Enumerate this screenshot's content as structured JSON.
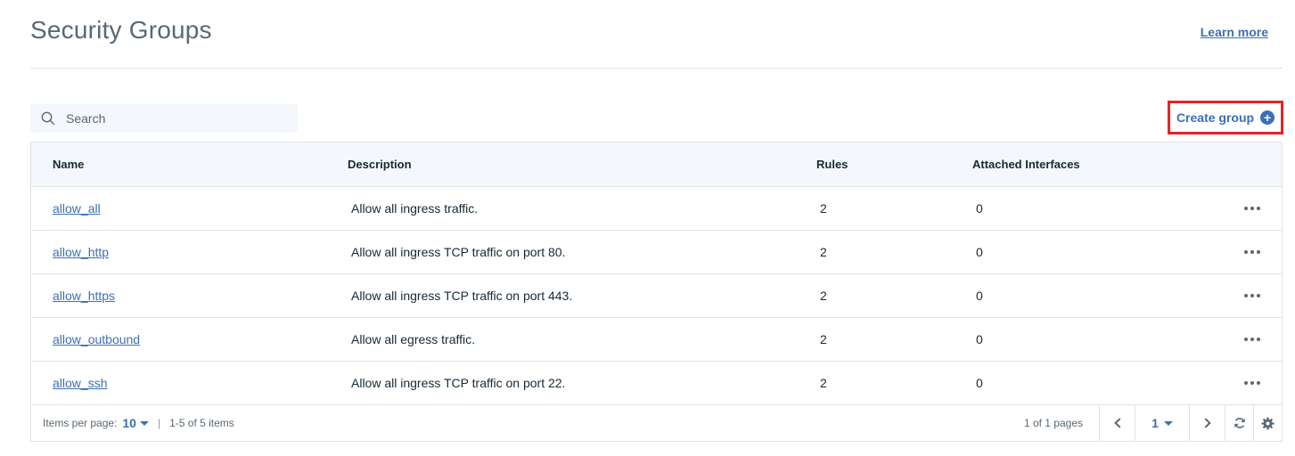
{
  "header": {
    "title": "Security Groups",
    "learn_more": "Learn more"
  },
  "toolbar": {
    "search_placeholder": "Search",
    "create_label": "Create group"
  },
  "table": {
    "columns": [
      "Name",
      "Description",
      "Rules",
      "Attached Interfaces"
    ],
    "rows": [
      {
        "name": "allow_all",
        "description": "Allow all ingress traffic.",
        "rules": "2",
        "attached": "0"
      },
      {
        "name": "allow_http",
        "description": "Allow all ingress TCP traffic on port 80.",
        "rules": "2",
        "attached": "0"
      },
      {
        "name": "allow_https",
        "description": "Allow all ingress TCP traffic on port 443.",
        "rules": "2",
        "attached": "0"
      },
      {
        "name": "allow_outbound",
        "description": "Allow all egress traffic.",
        "rules": "2",
        "attached": "0"
      },
      {
        "name": "allow_ssh",
        "description": "Allow all ingress TCP traffic on port 22.",
        "rules": "2",
        "attached": "0"
      }
    ]
  },
  "pagination": {
    "items_per_page_label": "Items per page:",
    "items_per_page_value": "10",
    "range_text": "1-5 of 5 items",
    "pages_text": "1 of 1 pages",
    "current_page": "1"
  },
  "icons": [
    "search-icon",
    "plus-circle-icon",
    "overflow-menu-icon",
    "chevron-down-icon",
    "chevron-left-icon",
    "chevron-right-icon",
    "refresh-icon",
    "gear-icon"
  ],
  "colors": {
    "accent": "#3d70b2",
    "highlight_border": "#e62325",
    "header_bg": "#f4f7fb",
    "border": "#dfe3e6"
  }
}
